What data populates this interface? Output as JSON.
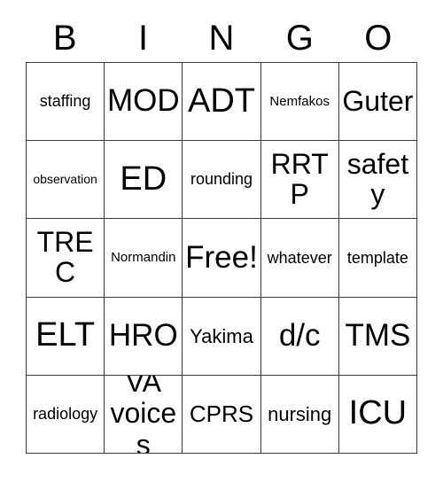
{
  "card": {
    "title": "BINGO",
    "header_letters": [
      "B",
      "I",
      "N",
      "G",
      "O"
    ],
    "free_space_label": "Free!",
    "colors": {
      "background": "#ffffff",
      "text": "#000000",
      "grid_line": "#3a3a3a"
    },
    "grid": {
      "rows": 5,
      "columns": 5
    },
    "cells": [
      [
        {
          "text": "staffing",
          "size": "md"
        },
        {
          "text": "MOD",
          "size": "xxxl"
        },
        {
          "text": "ADT",
          "size": "huge"
        },
        {
          "text": "Nemfakos",
          "size": "sm"
        },
        {
          "text": "Guter",
          "size": "xxl"
        }
      ],
      [
        {
          "text": "observation",
          "size": "xs"
        },
        {
          "text": "ED",
          "size": "huge"
        },
        {
          "text": "rounding",
          "size": "md"
        },
        {
          "text": "RRTP",
          "size": "xxl"
        },
        {
          "text": "safety",
          "size": "xxl"
        }
      ],
      [
        {
          "text": "TREC",
          "size": "xxl"
        },
        {
          "text": "Normandin",
          "size": "sm"
        },
        {
          "text": "Free!",
          "size": "xxxl"
        },
        {
          "text": "whatever",
          "size": "md"
        },
        {
          "text": "template",
          "size": "md"
        }
      ],
      [
        {
          "text": "ELT",
          "size": "huge"
        },
        {
          "text": "HRO",
          "size": "xxxl"
        },
        {
          "text": "Yakima",
          "size": "lg"
        },
        {
          "text": "d/c",
          "size": "xxxl"
        },
        {
          "text": "TMS",
          "size": "xxxl"
        }
      ],
      [
        {
          "text": "radiology",
          "size": "md"
        },
        {
          "text": "VA\nvoices",
          "size": "xxl",
          "lines": 2
        },
        {
          "text": "CPRS",
          "size": "xl"
        },
        {
          "text": "nursing",
          "size": "lg"
        },
        {
          "text": "ICU",
          "size": "huge"
        }
      ]
    ]
  }
}
